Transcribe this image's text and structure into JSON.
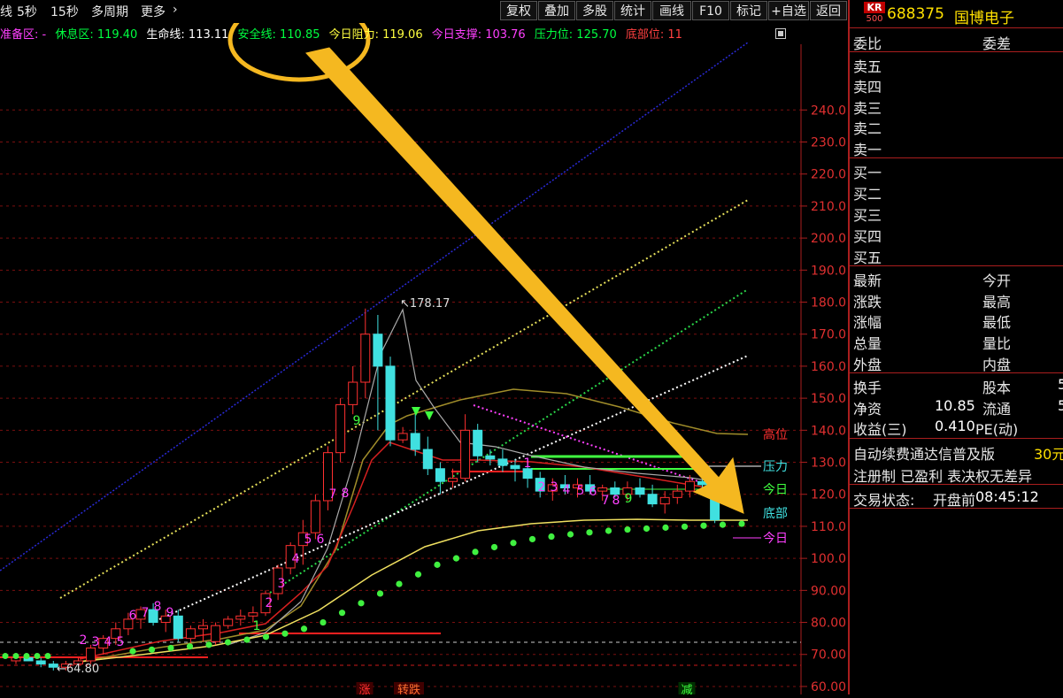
{
  "toolbar": {
    "left_items": [
      "线",
      "5秒",
      "15秒",
      "多周期",
      "更多",
      "›"
    ],
    "buttons": [
      "复权",
      "叠加",
      "多股",
      "统计",
      "画线",
      "F10",
      "标记",
      "+自选",
      "返回"
    ]
  },
  "indicators": [
    {
      "label": "准备区: -",
      "color": "#ff40ff"
    },
    {
      "label": "休息区: 119.40",
      "color": "#00ff40"
    },
    {
      "label": "生命线: 113.11",
      "color": "#ffffff"
    },
    {
      "label": "安全线: 110.85",
      "color": "#00ff40"
    },
    {
      "label": "今日阻力: 119.06",
      "color": "#ffff40"
    },
    {
      "label": "今日支撑: 103.76",
      "color": "#ff40ff"
    },
    {
      "label": "压力位: 125.70",
      "color": "#00ff40"
    },
    {
      "label": "底部位: 11",
      "color": "#ff4040"
    }
  ],
  "chart_data": {
    "type": "candlestick",
    "y_ticks": [
      240,
      230,
      220,
      210,
      200,
      190,
      180,
      170,
      160,
      150,
      140,
      130,
      120,
      110,
      100,
      90,
      80,
      70,
      60
    ],
    "y_tick_labels": [
      "240.0",
      "230.0",
      "220.0",
      "210.0",
      "200.0",
      "190.0",
      "180.0",
      "170.0",
      "160.0",
      "150.0",
      "140.0",
      "130.0",
      "120.0",
      "110.0",
      "100.0",
      "90.00",
      "80.00",
      "70.00",
      "60.00"
    ],
    "ylim": [
      57.5,
      255
    ],
    "high_label": "178.17",
    "low_label": "64.80",
    "right_labels": [
      "高位",
      "压力",
      "今日",
      "底部",
      "今日"
    ],
    "bottom_tags": [
      "涨",
      "转跌",
      "减"
    ],
    "count_labels": [
      "2",
      "3",
      "4",
      "5",
      "6",
      "7",
      "8",
      "9",
      "1",
      "2",
      "3",
      "4",
      "5",
      "6",
      "7",
      "8",
      "9",
      "1",
      "2",
      "3",
      "4",
      "5",
      "6",
      "7",
      "8",
      "9"
    ],
    "candles": [
      [
        68,
        70,
        67,
        69
      ],
      [
        69,
        70,
        68,
        68
      ],
      [
        68,
        69,
        66,
        67
      ],
      [
        67,
        68,
        65,
        66
      ],
      [
        66,
        68,
        65,
        67
      ],
      [
        67,
        69,
        66,
        68
      ],
      [
        68,
        73,
        67,
        72
      ],
      [
        72,
        76,
        70,
        75
      ],
      [
        75,
        80,
        73,
        78
      ],
      [
        78,
        83,
        76,
        81
      ],
      [
        81,
        85,
        78,
        84
      ],
      [
        84,
        86,
        79,
        80
      ],
      [
        80,
        84,
        77,
        82
      ],
      [
        82,
        84,
        74,
        75
      ],
      [
        75,
        79,
        72,
        78
      ],
      [
        78,
        81,
        74,
        79
      ],
      [
        74,
        80,
        73,
        79
      ],
      [
        79,
        82,
        78,
        81
      ],
      [
        81,
        84,
        79,
        82
      ],
      [
        82,
        85,
        80,
        83
      ],
      [
        83,
        90,
        82,
        89
      ],
      [
        89,
        98,
        87,
        97
      ],
      [
        97,
        105,
        95,
        104
      ],
      [
        104,
        112,
        98,
        108
      ],
      [
        108,
        120,
        106,
        118
      ],
      [
        118,
        135,
        115,
        133
      ],
      [
        133,
        150,
        130,
        148
      ],
      [
        148,
        160,
        145,
        155
      ],
      [
        155,
        178,
        150,
        170
      ],
      [
        170,
        176,
        140,
        160
      ],
      [
        160,
        163,
        135,
        137
      ],
      [
        137,
        141,
        136,
        139
      ],
      [
        139,
        145,
        132,
        134
      ],
      [
        134,
        138,
        126,
        128
      ],
      [
        128,
        130,
        120,
        124
      ],
      [
        124,
        128,
        122,
        125
      ],
      [
        125,
        145,
        124,
        140
      ],
      [
        140,
        142,
        130,
        132
      ],
      [
        132,
        134,
        129,
        131
      ],
      [
        131,
        134,
        127,
        129
      ],
      [
        129,
        131,
        124,
        128
      ],
      [
        128,
        130,
        122,
        125
      ],
      [
        125,
        127,
        119,
        121
      ],
      [
        121,
        125,
        118,
        123
      ],
      [
        123,
        126,
        120,
        122
      ],
      [
        122,
        125,
        119,
        123
      ],
      [
        123,
        126,
        120,
        121
      ],
      [
        121,
        123,
        118,
        122
      ],
      [
        122,
        124,
        119,
        120
      ],
      [
        120,
        124,
        118,
        122
      ],
      [
        122,
        125,
        119,
        120
      ],
      [
        120,
        123,
        116,
        117
      ],
      [
        117,
        121,
        114,
        119
      ],
      [
        119,
        123,
        117,
        121
      ],
      [
        121,
        126,
        119,
        124
      ],
      [
        124,
        128,
        121,
        123
      ],
      [
        123,
        126,
        111,
        112
      ]
    ]
  },
  "panel": {
    "stock_badge_top": "KR",
    "stock_badge_bottom": "500",
    "stock_code": "688375",
    "stock_name": "国博电子",
    "wei_bi": "委比",
    "wei_cha": "委差",
    "sell_levels": [
      "卖五",
      "卖四",
      "卖三",
      "卖二",
      "卖一"
    ],
    "buy_levels": [
      "买一",
      "买二",
      "买三",
      "买四",
      "买五"
    ],
    "stats_left": [
      "最新",
      "涨跌",
      "涨幅",
      "总量",
      "外盘"
    ],
    "stats_right": [
      "今开",
      "最高",
      "最低",
      "量比",
      "内盘"
    ],
    "turnover": "换手",
    "share_capital": "股本",
    "share_capital_value": "5",
    "net_asset": "净资",
    "net_asset_value": "10.85",
    "float_label": "流通",
    "float_value": "5",
    "eps_label": "收益(三)",
    "eps_value": "0.410",
    "pe_label": "PE(动)",
    "promo": "自动续费通达信普及版",
    "promo_price": "30元",
    "reg_info": "注册制 已盈利 表决权无差异",
    "trade_status_label": "交易状态:",
    "trade_status": "开盘前",
    "trade_time": "08:45:12"
  }
}
